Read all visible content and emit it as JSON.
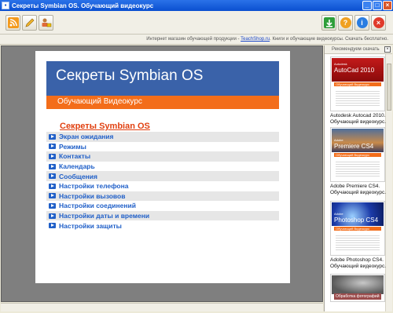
{
  "window": {
    "title": "Секреты Symbian OS. Обучающий видеокурс"
  },
  "toolbar": {
    "left_buttons": [
      "rss-icon",
      "pencil-icon",
      "lock-user-icon"
    ],
    "right_buttons": [
      "download-icon",
      "help-icon",
      "info-icon",
      "close-icon"
    ],
    "colors": {
      "download": "#2e9e3a",
      "help": "#f0a020",
      "info": "#2a7de1",
      "close": "#e03a2a"
    }
  },
  "infobar": {
    "text_before": "Интернет магазин обучающей продукции - ",
    "link": "TeachShop.ru",
    "text_after": ". Книги и обучающие видеокурсы. Скачать бесплатно."
  },
  "document": {
    "banner_title": "Секреты Symbian OS",
    "subtitle": "Обучающий Видеокурс",
    "contents_title": "Секреты Symbian OS",
    "menu": [
      "Экран ожидания",
      "Режимы",
      "Контакты",
      "Календарь",
      "Сообщения",
      "Настройки телефона",
      "Настройки вызовов",
      "Настройки соединений",
      "Настройки даты и времени",
      "Настройки защиты"
    ],
    "colors": {
      "banner": "#3a62a9",
      "accent": "#f36d1a",
      "link": "#1f5fc8",
      "title": "#e14010"
    }
  },
  "sidebar": {
    "header": "Рекомендуем скачать",
    "items": [
      {
        "cover_brand": "Autodesk",
        "cover_name": "AutoCad 2010",
        "cover_band": "Обучающий Видеокурс",
        "caption": [
          "Autodesk Autocad 2010.",
          "Обучающий видеокурс."
        ]
      },
      {
        "cover_brand": "Adobe",
        "cover_name": "Premiere CS4",
        "cover_band": "Обучающий Видеокурс",
        "caption": [
          "Adobe Premiere CS4.",
          "Обучающий видеокурс."
        ]
      },
      {
        "cover_brand": "Adobe",
        "cover_name": "Photoshop CS4",
        "cover_band": "Обучающий Видеокурс",
        "caption": [
          "Adobe Photoshop CS4.",
          "Обучающий видеокурс."
        ]
      },
      {
        "cover_band": "Обработка фотографий"
      }
    ]
  }
}
